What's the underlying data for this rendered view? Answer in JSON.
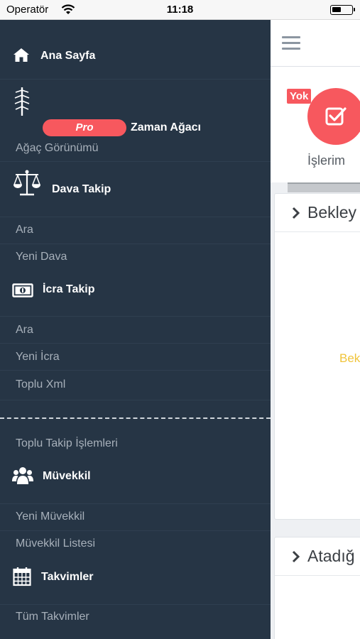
{
  "status_bar": {
    "carrier": "Operatör",
    "time": "11:18"
  },
  "drawer": {
    "ana_sayfa": "Ana Sayfa",
    "pro_badge": "Pro",
    "zaman_agaci": "Zaman Ağacı",
    "agac_gorunumu": "Ağaç Görünümü",
    "dava_takip": "Dava Takip",
    "dava_ara": "Ara",
    "yeni_dava": "Yeni Dava",
    "icra_takip": "İcra Takip",
    "icra_ara": "Ara",
    "yeni_icra": "Yeni İcra",
    "toplu_xml": "Toplu Xml",
    "toplu_takip": "Toplu Takip İşlemleri",
    "muvekkil": "Müvekkil",
    "yeni_muvekkil": "Yeni Müvekkil",
    "muvekkil_listesi": "Müvekkil Listesi",
    "takvimler": "Takvimler",
    "tum_takvimler": "Tüm Takvimler"
  },
  "main": {
    "badge": "Yok",
    "islerim": "İşlerim",
    "panel1_title": "Bekley",
    "panel1_empty": "Bek",
    "panel2_title": "Atadığ"
  },
  "colors": {
    "drawer_bg": "#263545",
    "accent": "#f7585e",
    "warning": "#f0c43a"
  }
}
